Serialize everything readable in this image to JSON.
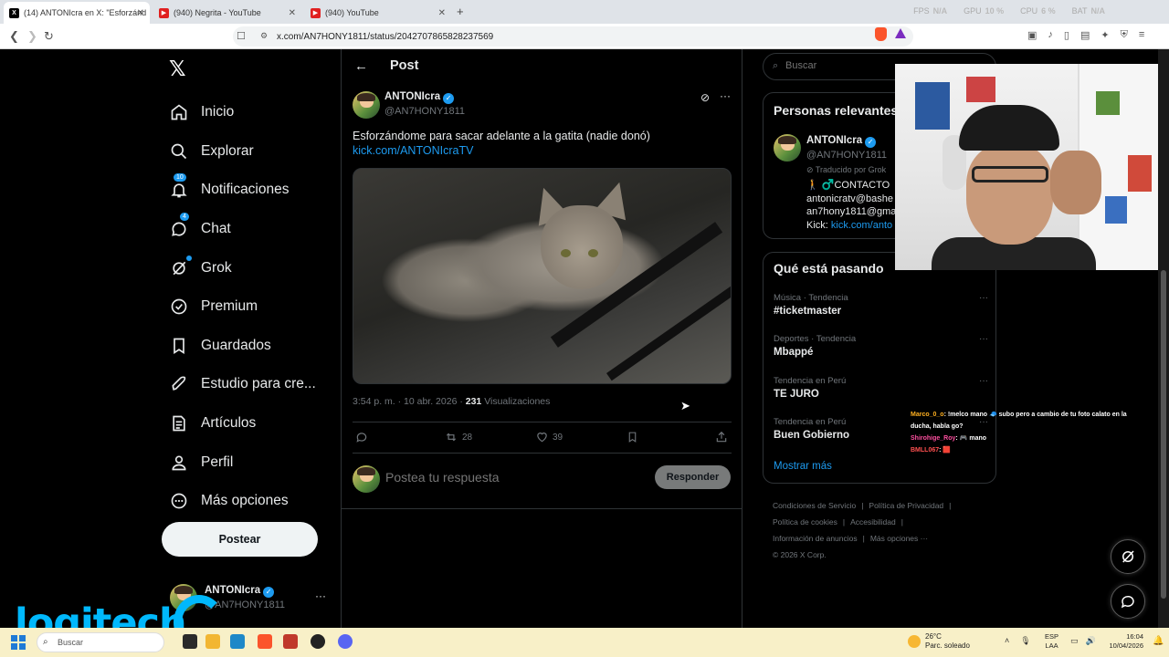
{
  "browser": {
    "tabs": [
      {
        "title": "(14) ANTONIcra en X: \"Esforzánd",
        "active": true
      },
      {
        "title": "(940) Negrita - YouTube",
        "active": false
      },
      {
        "title": "(940) YouTube",
        "active": false
      }
    ],
    "stats": {
      "fps_label": "FPS",
      "fps_value": "N/A",
      "gpu_label": "GPU",
      "gpu_value": "10 %",
      "cpu_label": "CPU",
      "cpu_value": "6 %",
      "bat_label": "BAT",
      "bat_value": "N/A"
    },
    "url": "x.com/AN7HONY1811/status/2042707865828237569"
  },
  "sidebar": {
    "logo": "𝕏",
    "items": [
      {
        "label": "Inicio",
        "icon": "home-icon"
      },
      {
        "label": "Explorar",
        "icon": "search-icon"
      },
      {
        "label": "Notificaciones",
        "icon": "bell-icon",
        "badge": "10"
      },
      {
        "label": "Chat",
        "icon": "chat-icon",
        "badge": "4"
      },
      {
        "label": "Grok",
        "icon": "grok-icon"
      },
      {
        "label": "Premium",
        "icon": "premium-icon"
      },
      {
        "label": "Guardados",
        "icon": "bookmark-icon"
      },
      {
        "label": "Estudio para cre...",
        "icon": "rocket-icon"
      },
      {
        "label": "Artículos",
        "icon": "article-icon"
      },
      {
        "label": "Perfil",
        "icon": "person-icon"
      },
      {
        "label": "Más opciones",
        "icon": "more-circle-icon"
      }
    ],
    "post_button": "Postear",
    "account": {
      "name": "ANTONIcra",
      "handle": "@AN7HONY1811"
    }
  },
  "post": {
    "header_title": "Post",
    "author": {
      "name": "ANTONIcra",
      "handle": "@AN7HONY1811"
    },
    "text": "Esforzándome para sacar adelante a la gatita (nadie donó)",
    "link": "kick.com/ANTONIcraTV",
    "meta_time": "3:54 p. m. · 10 abr. 2026 · ",
    "views_count": "231",
    "views_label": " Visualizaciones",
    "retweets": "28",
    "likes": "39",
    "reply_placeholder": "Postea tu respuesta",
    "reply_button": "Responder"
  },
  "right": {
    "search_placeholder": "Buscar",
    "relevant_title": "Personas relevantes",
    "relevant": {
      "name": "ANTONIcra",
      "handle": "@AN7HONY1811",
      "grok_note": "Traducido por Grok",
      "bio_line1": "🚶 ♂️CONTACTO",
      "bio_line2": "antonicratv@bashe",
      "bio_line3": "an7hony1811@gmai",
      "bio_kick_label": "Kick: ",
      "bio_kick_link": "kick.com/anto"
    },
    "trends_title": "Qué está pasando",
    "trends": [
      {
        "category": "Música · Tendencia",
        "name": "#ticketmaster"
      },
      {
        "category": "Deportes · Tendencia",
        "name": "Mbappé"
      },
      {
        "category": "Tendencia en Perú",
        "name": "TE JURO"
      },
      {
        "category": "Tendencia en Perú",
        "name": "Buen Gobierno"
      }
    ],
    "show_more": "Mostrar más",
    "footer": {
      "tos": "Condiciones de Servicio",
      "privacy": "Política de Privacidad",
      "cookies": "Política de cookies",
      "accessibility": "Accesibilidad",
      "ads": "Información de anuncios",
      "more": "Más opciones ···",
      "copyright": "© 2026 X Corp."
    }
  },
  "stream_chat": [
    {
      "user": "Marco_0_o",
      "message": ": !melco mano 🧢 subo pero a cambio de tu foto calato en la"
    },
    {
      "user": "",
      "message": "ducha, habla go?"
    },
    {
      "user": "Shirohige_Roy",
      "message": ": 🎮 mano"
    },
    {
      "user": "BMLL067",
      "message": ": 🟥"
    }
  ],
  "overlay_logo": "logitech",
  "taskbar": {
    "search_placeholder": "Buscar",
    "weather_temp": "26°C",
    "weather_desc": "Parc. soleado",
    "lang_top": "ESP",
    "lang_bottom": "LAA",
    "time": "16:04",
    "date": "10/04/2026"
  },
  "colors": {
    "accent": "#1d9bf0",
    "background": "#000000",
    "text": "#e7e9ea",
    "muted": "#71767b",
    "taskbar": "#f8f0c8",
    "logitech": "#00b8fc"
  }
}
